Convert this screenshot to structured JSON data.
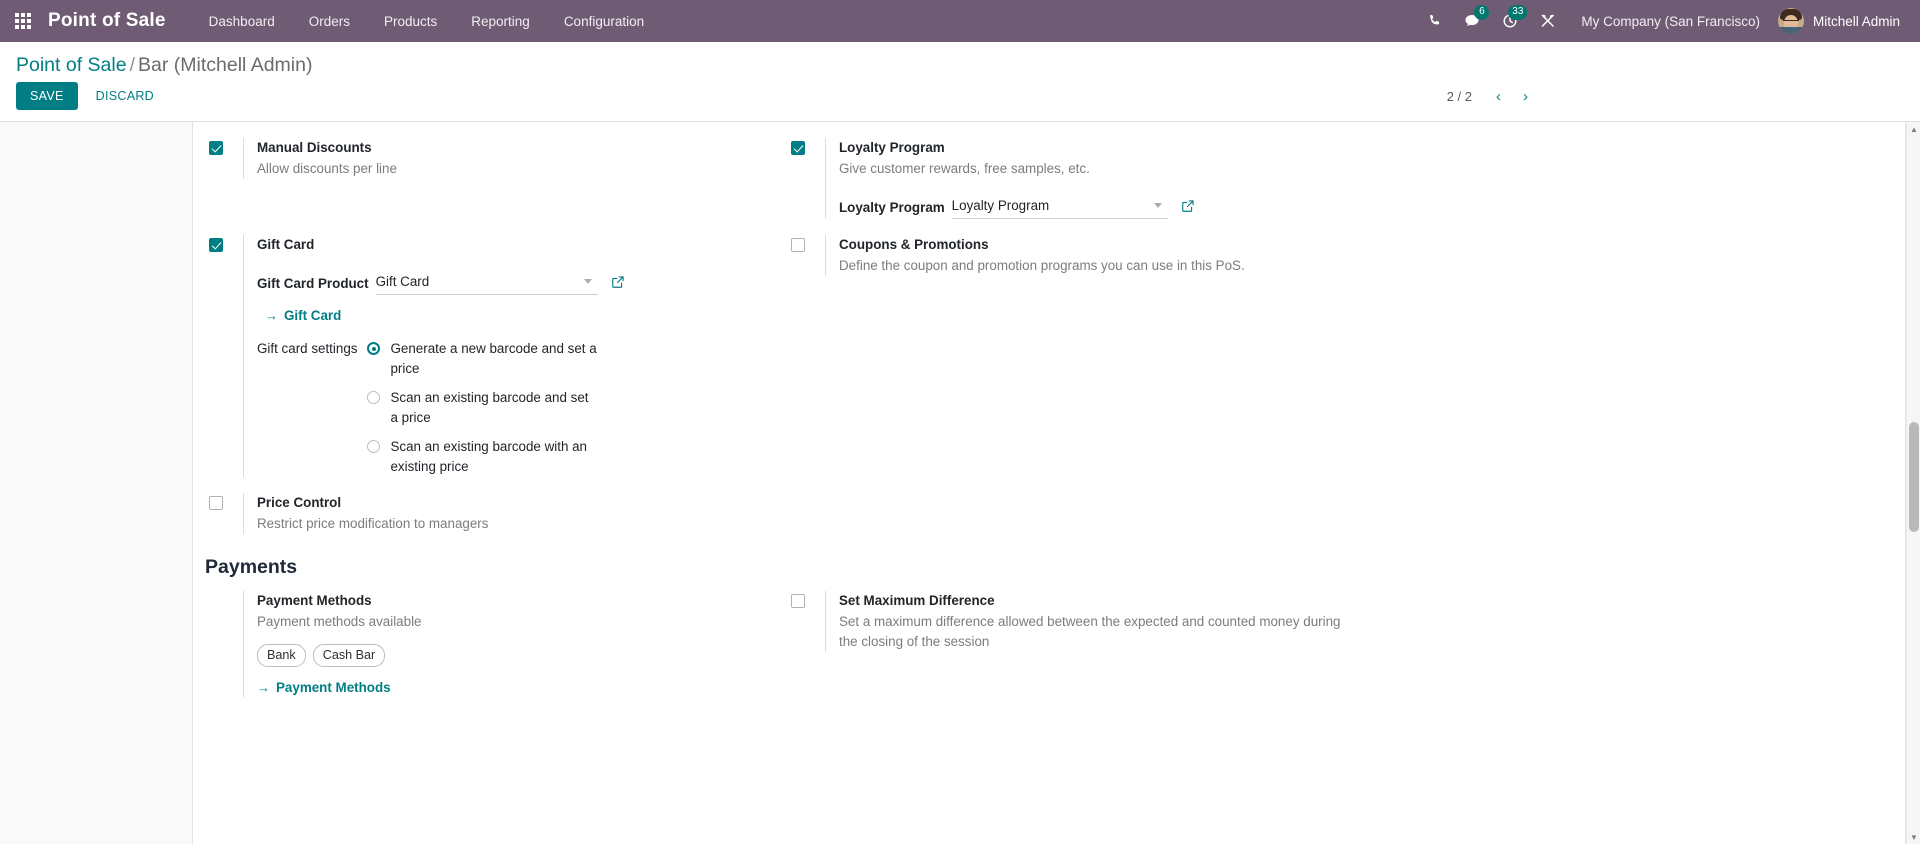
{
  "navbar": {
    "apps_icon": "grid-apps-icon",
    "brand": "Point of Sale",
    "menu": [
      {
        "label": "Dashboard"
      },
      {
        "label": "Orders"
      },
      {
        "label": "Products"
      },
      {
        "label": "Reporting"
      },
      {
        "label": "Configuration"
      }
    ],
    "icons": [
      {
        "name": "phone-icon",
        "badge": null
      },
      {
        "name": "messages-icon",
        "badge": "6"
      },
      {
        "name": "activities-clock-icon",
        "badge": "33"
      },
      {
        "name": "debug-tools-icon",
        "badge": null
      }
    ],
    "company": "My Company (San Francisco)",
    "user_name": "Mitchell Admin",
    "avatar_name": "user-avatar"
  },
  "control_panel": {
    "breadcrumb_root": "Point of Sale",
    "breadcrumb_separator": "/",
    "breadcrumb_current": "Bar (Mitchell Admin)",
    "save_label": "SAVE",
    "discard_label": "DISCARD",
    "pager_value": "2 / 2",
    "pager_prev": "‹",
    "pager_next": "›"
  },
  "settings": {
    "manual_discounts": {
      "title": "Manual Discounts",
      "desc": "Allow discounts per line",
      "checked": true
    },
    "loyalty_program": {
      "title": "Loyalty Program",
      "desc": "Give customer rewards, free samples, etc.",
      "checked": true,
      "field_label": "Loyalty Program",
      "field_value": "Loyalty Program"
    },
    "gift_card": {
      "title": "Gift Card",
      "checked": true,
      "product_label": "Gift Card Product",
      "product_value": "Gift Card",
      "link_label": "Gift Card",
      "link_arrow": "→",
      "settings_label": "Gift card settings",
      "options": [
        {
          "label": "Generate a new barcode and set a price",
          "selected": true
        },
        {
          "label": "Scan an existing barcode and set a price",
          "selected": false
        },
        {
          "label": "Scan an existing barcode with an existing price",
          "selected": false
        }
      ]
    },
    "coupons": {
      "title": "Coupons & Promotions",
      "desc": "Define the coupon and promotion programs you can use in this PoS.",
      "checked": false
    },
    "price_control": {
      "title": "Price Control",
      "desc": "Restrict price modification to managers",
      "checked": false
    },
    "payments_heading": "Payments",
    "payment_methods": {
      "title": "Payment Methods",
      "desc": "Payment methods available",
      "tags": [
        "Bank",
        "Cash Bar"
      ],
      "link_label": "Payment Methods",
      "link_arrow": "→"
    },
    "max_difference": {
      "title": "Set Maximum Difference",
      "desc": "Set a maximum difference allowed between the expected and counted money during the closing of the session",
      "checked": false
    }
  },
  "colors": {
    "navbar_bg": "#6f5b73",
    "accent_teal": "#017e84",
    "badge_bg": "#00786f",
    "muted_text": "#7c7c7c"
  }
}
